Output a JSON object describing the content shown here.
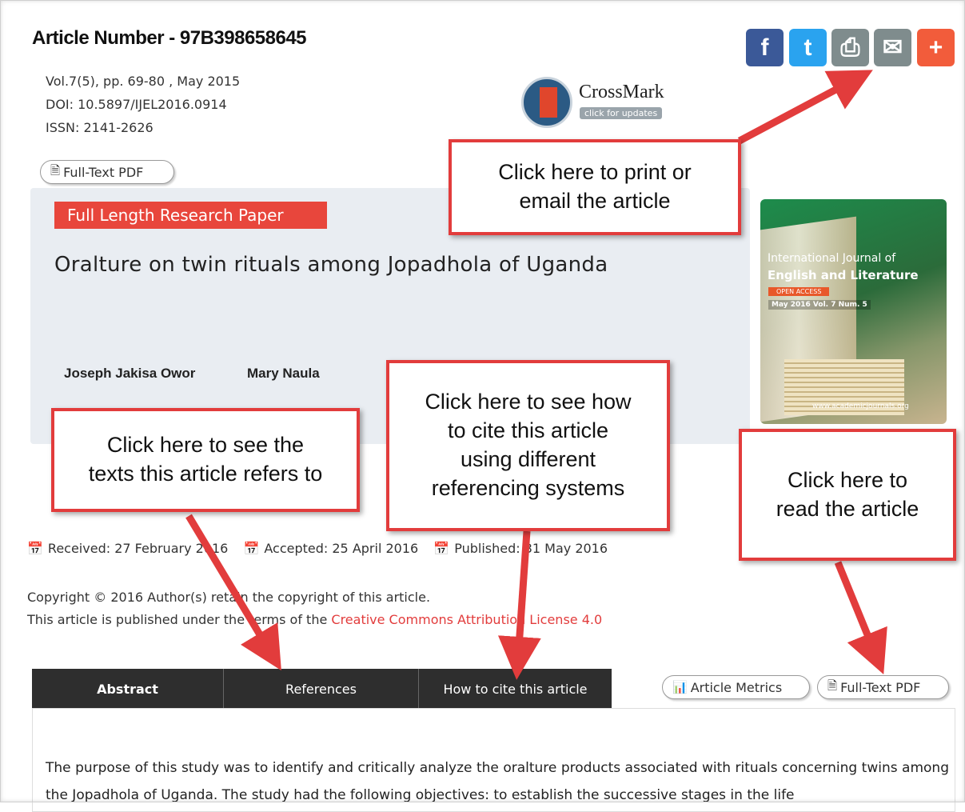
{
  "article": {
    "number_label": "Article Number - 97B398658645",
    "volume": "Vol.7(5), pp. 69-80 , May 2015",
    "doi": "DOI: 10.5897/IJEL2016.0914",
    "issn": "ISSN: 2141-2626",
    "type_badge": "Full Length Research Paper",
    "title": "Oralture on twin rituals among Jopadhola of Uganda",
    "authors": [
      "Joseph Jakisa Owor",
      "Mary Naula"
    ]
  },
  "crossmark": {
    "title": "CrossMark",
    "subtitle": "click for updates"
  },
  "share_icons": [
    "facebook-icon",
    "twitter-icon",
    "print-icon",
    "email-icon",
    "add-icon"
  ],
  "share_glyphs": {
    "facebook": "f",
    "twitter": "t",
    "print": "⎙",
    "email": "✉",
    "add": "+"
  },
  "buttons": {
    "full_text_pdf_top": "Full-Text PDF",
    "article_metrics": "Article Metrics",
    "full_text_pdf_bottom": "Full-Text PDF"
  },
  "cover": {
    "line1": "International Journal of",
    "line2": "English and Literature",
    "open_access": "OPEN ACCESS",
    "issue": "May 2016  Vol. 7 Num. 5",
    "url": "www.academicjournals.org"
  },
  "callouts": {
    "print_email": "Click here to print or\nemail the article",
    "cite": "Click here to see how\nto cite this article\nusing different\nreferencing systems",
    "references": "Click here to see the\ntexts this article refers to",
    "read": "Click here to\nread the article"
  },
  "dates": {
    "received": "Received: 27 February 2016",
    "accepted": "Accepted: 25 April 2016",
    "published": "Published: 31 May 2016"
  },
  "copyright": {
    "line1": "Copyright © 2016 Author(s) retain the copyright of this article.",
    "line2_prefix": "This article is published under the terms of the ",
    "license_link": "Creative Commons Attribution License 4.0"
  },
  "tabs": [
    "Abstract",
    "References",
    "How to cite this article"
  ],
  "abstract_text": "The purpose of this study was to identify and critically analyze the oralture products associated with rituals concerning twins among the Jopadhola of Uganda. The study had the following objectives: to establish the successive stages in the life",
  "colors": {
    "accent_red": "#e23c3c",
    "facebook": "#3b5998",
    "twitter": "#2aa3ef",
    "tab_dark": "#2e2e2e"
  }
}
